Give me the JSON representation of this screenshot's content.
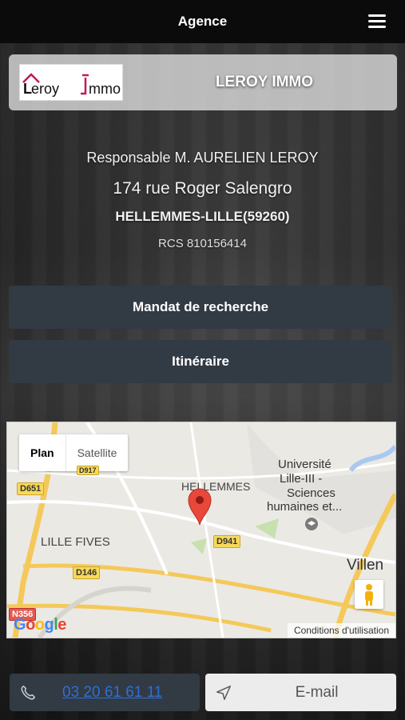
{
  "topbar": {
    "title": "Agence",
    "menu_icon": "hamburger-menu-icon"
  },
  "agency": {
    "logo_text_1": "eroy",
    "logo_text_2": "mmo",
    "name": "LEROY IMMO",
    "brand_color": "#c2185b"
  },
  "info": {
    "responsable": "Responsable M. AURELIEN LEROY",
    "street": "174 rue Roger Salengro",
    "city": "HELLEMMES-LILLE(59260)",
    "rcs": "RCS 810156414"
  },
  "actions": {
    "mandat_label": "Mandat de recherche",
    "itineraire_label": "Itinéraire"
  },
  "map": {
    "type_plan": "Plan",
    "type_satellite": "Satellite",
    "labels": {
      "hellemmes": "HELLEMMES",
      "lille_fives": "LILLE FIVES",
      "universite": "Université",
      "lille3": "Lille-III -",
      "sciences": "Sciences",
      "humaines": "humaines et...",
      "villen": "Villen"
    },
    "roads": {
      "d651": "D651",
      "d941": "D941",
      "d146": "D146",
      "d917": "D917",
      "n356": "N356"
    },
    "google": "Google",
    "conditions": "Conditions d'utilisation"
  },
  "contact": {
    "phone": "03 20 61 61 11",
    "email_label": "E-mail"
  }
}
